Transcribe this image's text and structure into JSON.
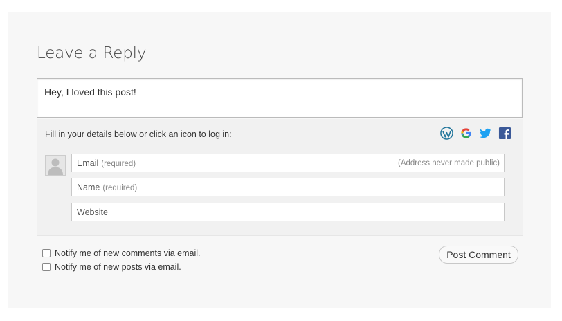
{
  "reply": {
    "title": "Leave a Reply",
    "comment_text": "Hey, I loved this post!"
  },
  "details": {
    "prompt": "Fill in your details below or click an icon to log in:",
    "social_icons": [
      "wordpress-icon",
      "google-icon",
      "twitter-icon",
      "facebook-icon"
    ],
    "email_label": "Email",
    "email_required": "(required)",
    "email_note": "(Address never made public)",
    "name_label": "Name",
    "name_required": "(required)",
    "website_label": "Website"
  },
  "options": {
    "notify_comments": "Notify me of new comments via email.",
    "notify_posts": "Notify me of new posts via email."
  },
  "actions": {
    "post_comment": "Post Comment"
  },
  "colors": {
    "wordpress": "#21759b",
    "twitter": "#1da1f2",
    "facebook": "#3b5998",
    "panel_bg": "#f7f7f7"
  }
}
